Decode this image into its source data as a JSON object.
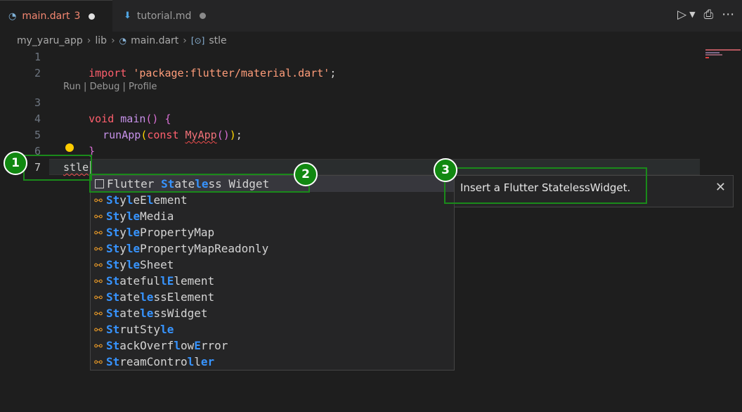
{
  "tabs": [
    {
      "label": "main.dart",
      "badge": "3",
      "icon": "dart-file-icon"
    },
    {
      "label": "tutorial.md",
      "icon": "markdown-file-icon"
    }
  ],
  "toolbar": {
    "run_icon": "run-debug-icon",
    "print_icon": "print-icon",
    "more_icon": "more-actions-icon"
  },
  "breadcrumb": [
    "my_yaru_app",
    "lib",
    "main.dart",
    "stle"
  ],
  "editor": {
    "line_numbers": [
      "1",
      "2",
      "3",
      "4",
      "5",
      "6",
      "7"
    ],
    "lines": {
      "l1": {
        "kw": "import",
        "str": "'package:flutter/material.dart'",
        "end": ";"
      },
      "code_lens": "Run | Debug | Profile",
      "l3": {
        "kw": "void",
        "fn": "main",
        "rest": "() {"
      },
      "l4": {
        "fn": "runApp",
        "open": "(",
        "kw": "const",
        "cls": "MyApp",
        "inner": "()",
        "close": ")",
        "end": ";"
      },
      "l5": "}",
      "l7": "stle"
    }
  },
  "suggestions": [
    {
      "pre": "Flutter ",
      "h1": "St",
      "m1": "ate",
      "h2": "le",
      "m2": "ss Widget",
      "m3": "",
      "h3": "",
      "m4": "",
      "kind": "snippet"
    },
    {
      "pre": "",
      "h1": "St",
      "m1": "y",
      "h2": "l",
      "m2": "eE",
      "h3": "l",
      "m3": "",
      "m4": "ement",
      "kind": "class"
    },
    {
      "pre": "",
      "h1": "St",
      "m1": "y",
      "h2": "le",
      "m2": "Media",
      "m3": "",
      "h3": "",
      "m4": "",
      "kind": "class"
    },
    {
      "pre": "",
      "h1": "St",
      "m1": "y",
      "h2": "le",
      "m2": "PropertyMap",
      "m3": "",
      "h3": "",
      "m4": "",
      "kind": "class"
    },
    {
      "pre": "",
      "h1": "St",
      "m1": "y",
      "h2": "le",
      "m2": "PropertyMapReadonly",
      "m3": "",
      "h3": "",
      "m4": "",
      "kind": "class"
    },
    {
      "pre": "",
      "h1": "St",
      "m1": "y",
      "h2": "le",
      "m2": "Sheet",
      "m3": "",
      "h3": "",
      "m4": "",
      "kind": "class"
    },
    {
      "pre": "",
      "h1": "St",
      "m1": "ateful",
      "h2": "lE",
      "m2": "lement",
      "m3": "",
      "h3": "",
      "m4": "",
      "kind": "class"
    },
    {
      "pre": "",
      "h1": "St",
      "m1": "ate",
      "h2": "le",
      "m2": "ssElement",
      "m3": "",
      "h3": "",
      "m4": "",
      "kind": "class"
    },
    {
      "pre": "",
      "h1": "St",
      "m1": "ate",
      "h2": "le",
      "m2": "ssWidget",
      "m3": "",
      "h3": "",
      "m4": "",
      "kind": "class"
    },
    {
      "pre": "",
      "h1": "St",
      "m1": "rutSty",
      "h2": "le",
      "m2": "",
      "m3": "",
      "h3": "",
      "m4": "",
      "kind": "class"
    },
    {
      "pre": "",
      "h1": "St",
      "m1": "ackOverf",
      "h2": "l",
      "m2": "ow",
      "h3": "E",
      "m3": "",
      "m4": "rror",
      "kind": "class"
    },
    {
      "pre": "",
      "h1": "St",
      "m1": "reamContro",
      "h2": "l",
      "m2": "l",
      "h3": "er",
      "m3": "",
      "m4": "",
      "kind": "class"
    }
  ],
  "details": {
    "text": "Insert a Flutter StatelessWidget.",
    "close_icon": "close-icon"
  },
  "annotations": [
    "1",
    "2",
    "3"
  ],
  "colors": {
    "accent": "#3794ff",
    "annotation_green": "#118811",
    "tab_active_text": "#f48771"
  }
}
